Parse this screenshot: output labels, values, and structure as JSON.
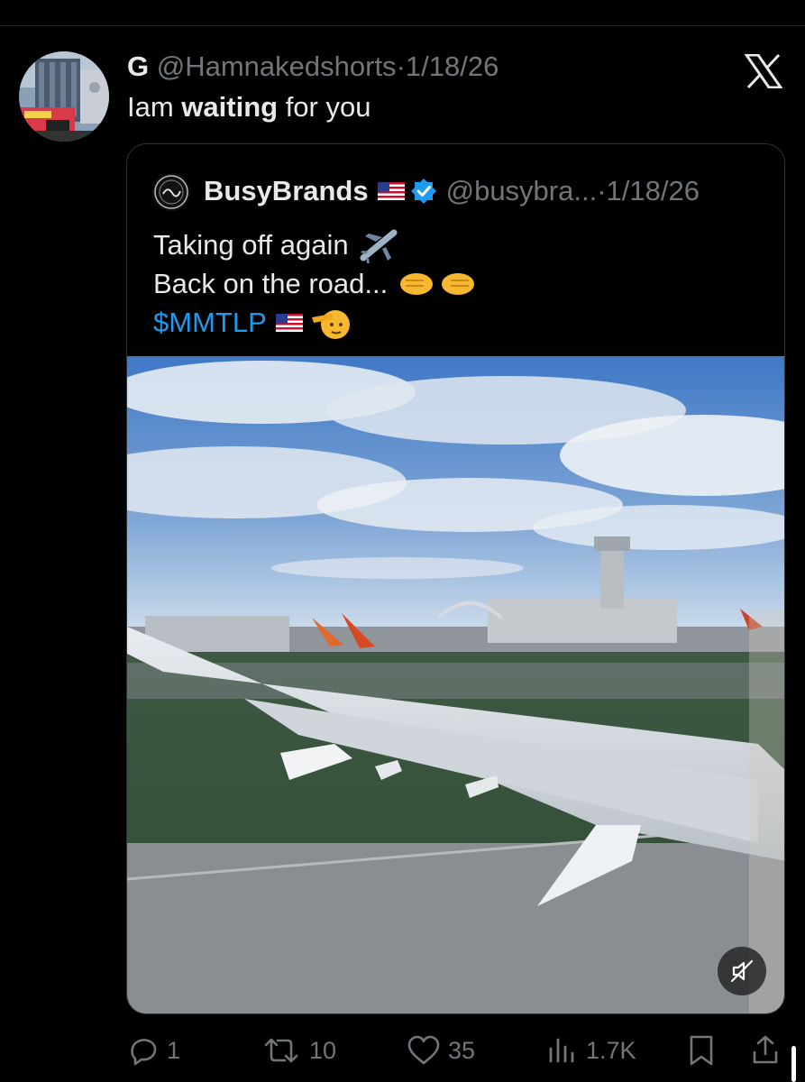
{
  "tweet": {
    "author_name": "G",
    "author_handle": "@Hamnakedshorts",
    "separator": "·",
    "date": "1/18/26",
    "text_before": "Iam ",
    "text_bold": "waiting",
    "text_after": " for you"
  },
  "quoted_tweet": {
    "author_name": "BusyBrands",
    "author_handle": "@busybra...",
    "separator": "·",
    "date": "1/18/26",
    "line1": "Taking off again",
    "line2": "Back on the road...",
    "cashtag": "$MMTLP"
  },
  "actions": {
    "replies": "1",
    "reposts": "10",
    "likes": "35",
    "views": "1.7K"
  },
  "icons": [
    "x-logo-icon",
    "verified-badge-icon",
    "us-flag-icon",
    "airplane-emoji",
    "fist-bump-emoji",
    "saluting-face-emoji",
    "mute-icon",
    "reply-icon",
    "repost-icon",
    "like-icon",
    "views-icon",
    "bookmark-icon",
    "share-icon"
  ],
  "colors": {
    "background": "#000000",
    "text": "#e7e9ea",
    "muted": "#71767b",
    "link": "#1d9bf0",
    "border": "#2f3336"
  }
}
